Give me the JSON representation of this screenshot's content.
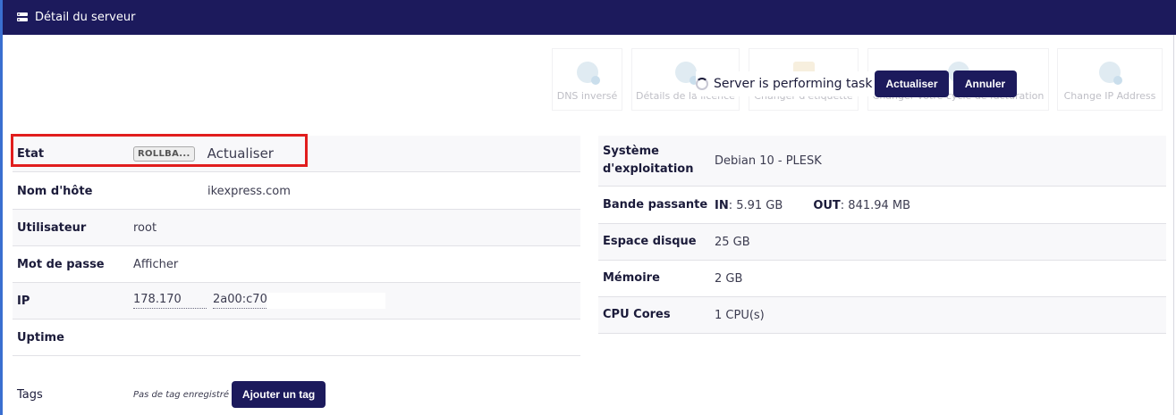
{
  "header": {
    "title": "Détail du serveur",
    "icon": "server-icon"
  },
  "actions": [
    {
      "label": "DNS inversé",
      "icon": "globe-gear-icon"
    },
    {
      "label": "Détails de la licence",
      "icon": "gear-icon"
    },
    {
      "label": "Changer d'étiquette",
      "icon": "tag-icon"
    },
    {
      "label": "Changer votre cycle de facturation",
      "icon": "cycle-icon"
    },
    {
      "label": "Change IP Address",
      "icon": "globe-gear-icon"
    }
  ],
  "task": {
    "message": "Server is performing task",
    "refresh_label": "Actualiser",
    "cancel_label": "Annuler"
  },
  "server": {
    "state_label": "Etat",
    "state_badge": "ROLLBA...",
    "state_refresh": "Actualiser",
    "hostname_label": "Nom d'hôte",
    "hostname_value": "ikexpress.com",
    "user_label": "Utilisateur",
    "user_value": "root",
    "password_label": "Mot de passe",
    "password_action": "Afficher",
    "ip_label": "IP",
    "ipv4": "178.170",
    "ipv6": "2a00:c70",
    "uptime_label": "Uptime",
    "uptime_value": "",
    "tags_label": "Tags",
    "tags_empty": "Pas de tag enregistré",
    "add_tag_label": "Ajouter un tag"
  },
  "specs": {
    "os_label": "Système d'exploitation",
    "os_value": "Debian 10 - PLESK",
    "bandwidth_label": "Bande passante",
    "bw_in_label": "IN",
    "bw_in_value": ": 5.91 GB",
    "bw_out_label": "OUT",
    "bw_out_value": ": 841.94 MB",
    "disk_label": "Espace disque",
    "disk_value": "25 GB",
    "memory_label": "Mémoire",
    "memory_value": "2 GB",
    "cpu_label": "CPU Cores",
    "cpu_value": "1 CPU(s)"
  },
  "colors": {
    "header_bg": "#1c1a5c",
    "button_bg": "#1c1a5c",
    "highlight": "#e11d1d",
    "link_red": "#e03030"
  }
}
